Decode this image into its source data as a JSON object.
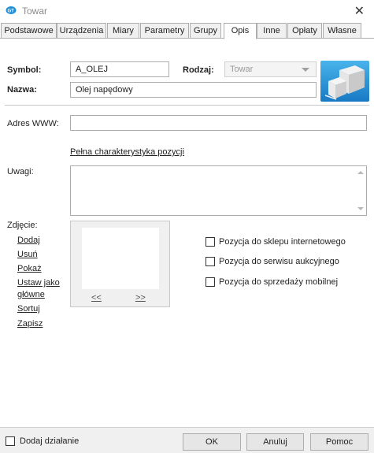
{
  "window": {
    "title": "Towar",
    "close_glyph": "✕"
  },
  "tabs": [
    {
      "label": "Podstawowe",
      "active": false
    },
    {
      "label": "Urządzenia",
      "active": false
    },
    {
      "label": "Miary",
      "active": false
    },
    {
      "label": "Parametry",
      "active": false
    },
    {
      "label": "Grupy",
      "active": false
    },
    {
      "label": "Opis",
      "active": true
    },
    {
      "label": "Inne",
      "active": false
    },
    {
      "label": "Opłaty",
      "active": false
    },
    {
      "label": "Własne",
      "active": false
    }
  ],
  "form": {
    "symbol_label": "Symbol:",
    "symbol_value": "A_OLEJ",
    "rodzaj_label": "Rodzaj:",
    "rodzaj_value": "Towar",
    "nazwa_label": "Nazwa:",
    "nazwa_value": "Olej napędowy",
    "www_label": "Adres WWW:",
    "www_value": "",
    "full_char_link": "Pełna charakterystyka pozycji",
    "uwagi_label": "Uwagi:",
    "uwagi_value": ""
  },
  "photo": {
    "label": "Zdjęcie:",
    "actions": [
      "Dodaj",
      "Usuń",
      "Pokaż",
      "Ustaw jako",
      "główne",
      "Sortuj",
      "Zapisz"
    ],
    "prev": "<<",
    "next": ">>"
  },
  "checkboxes": [
    {
      "label": "Pozycja do sklepu internetowego",
      "checked": false
    },
    {
      "label": "Pozycja do serwisu aukcyjnego",
      "checked": false
    },
    {
      "label": "Pozycja do sprzedaży mobilnej",
      "checked": false
    }
  ],
  "footer": {
    "add_action_label": "Dodaj działanie",
    "ok": "OK",
    "cancel": "Anuluj",
    "help": "Pomoc"
  },
  "icons": {
    "app": "app-logo-icon",
    "product": "product-boxes-icon",
    "globe": "globe-arrow-icon"
  },
  "colors": {
    "accent_blue": "#1f8fd8",
    "border": "#adadad",
    "background": "#ffffff"
  }
}
